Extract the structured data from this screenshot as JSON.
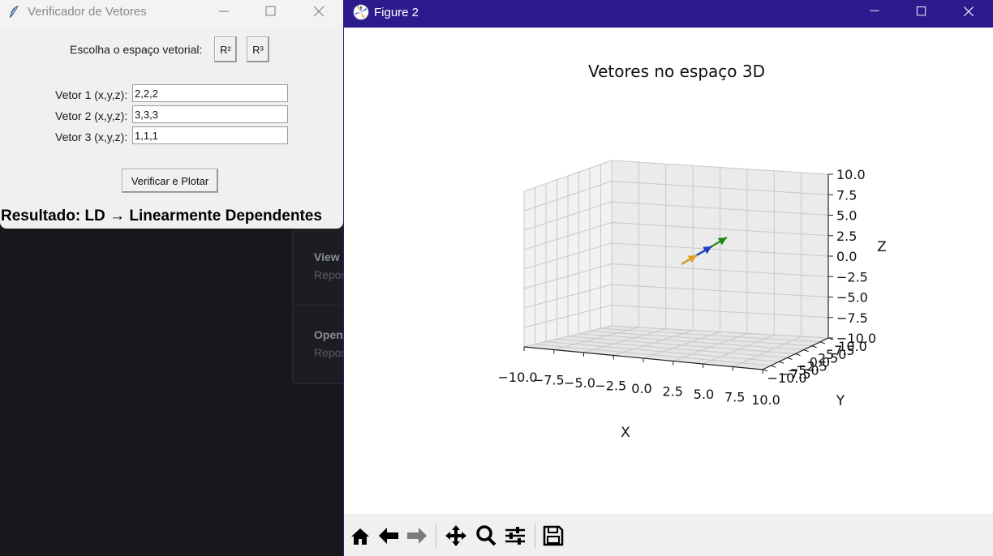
{
  "tk_window": {
    "title": "Verificador de Vetores",
    "space_label": "Escolha o espaço vetorial:",
    "r2_button": "R²",
    "r3_button": "R³",
    "vectors": [
      {
        "label": "Vetor 1 (x,y,z):",
        "value": "2,2,2"
      },
      {
        "label": "Vetor 2 (x,y,z):",
        "value": "3,3,3"
      },
      {
        "label": "Vetor 3 (x,y,z):",
        "value": "1,1,1"
      }
    ],
    "verify_button": "Verificar e Plotar",
    "result": "Resultado: LD → Linearmente Dependentes"
  },
  "background_app": {
    "items": [
      {
        "title": "View",
        "subtitle": "Repos"
      },
      {
        "title": "Open",
        "subtitle": "Repos"
      }
    ]
  },
  "figure_window": {
    "title": "Figure 2",
    "toolbar": [
      "home-icon",
      "back-arrow-icon",
      "forward-arrow-icon",
      "pan-icon",
      "zoom-icon",
      "configure-subplots-icon",
      "save-icon"
    ]
  },
  "chart_data": {
    "type": "3d-quiver",
    "title": "Vetores no espaço 3D",
    "xlabel": "X",
    "ylabel": "Y",
    "zlabel": "Z",
    "xlim": [
      -10,
      10
    ],
    "ylim": [
      -10,
      10
    ],
    "zlim": [
      -10,
      10
    ],
    "x_ticks": [
      "−10.0",
      "−7.5",
      "−5.0",
      "−2.5",
      "0.0",
      "2.5",
      "5.0",
      "7.5",
      "10.0"
    ],
    "y_ticks": [
      "−10.0",
      "−7.5",
      "−5.0",
      "−2.5",
      "0.0",
      "2.5",
      "5.0",
      "7.5",
      "10.0"
    ],
    "z_ticks": [
      "−10.0",
      "−7.5",
      "−5.0",
      "−2.5",
      "0.0",
      "2.5",
      "5.0",
      "7.5",
      "10.0"
    ],
    "grid": true,
    "vectors": [
      {
        "origin": [
          0,
          0,
          0
        ],
        "components": [
          2,
          2,
          2
        ],
        "color": "#1f3fbf"
      },
      {
        "origin": [
          0,
          0,
          0
        ],
        "components": [
          3,
          3,
          3
        ],
        "color": "#1a8a1a"
      },
      {
        "origin": [
          0,
          0,
          0
        ],
        "components": [
          1,
          1,
          1
        ],
        "color": "#e0a020"
      }
    ]
  }
}
